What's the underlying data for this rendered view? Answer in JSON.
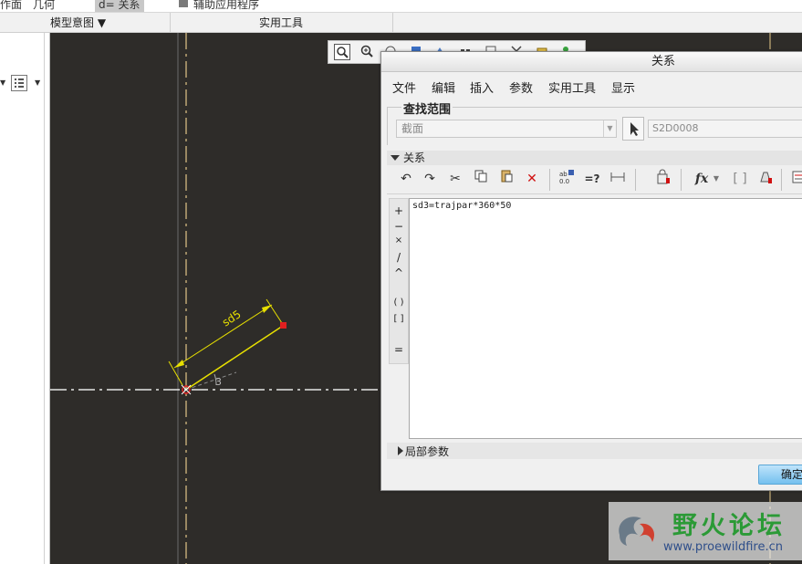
{
  "ribbon": {
    "top_items": [
      "作面",
      "几何",
      "d= 关系",
      "辅助应用程序"
    ],
    "groups": [
      "模型意图 ▼",
      "实用工具"
    ]
  },
  "sketch": {
    "dimension_label": "sd5",
    "angle_label": "3"
  },
  "dialog": {
    "title": "关系",
    "menu": [
      "文件",
      "编辑",
      "插入",
      "参数",
      "实用工具",
      "显示"
    ],
    "lookup_label": "查找范围",
    "scope_value": "截面",
    "selection_value": "S2D0008",
    "relations_label": "关系",
    "ops": [
      "+",
      "−",
      "×",
      "/",
      "^",
      "( )",
      "[ ]",
      "="
    ],
    "relation_text": "sd3=trajpar*360*50",
    "local_params_label": "局部参数",
    "ok_label": "确定"
  },
  "watermark": {
    "title": "野火论坛",
    "url": "www.proewildfire.cn"
  },
  "colors": {
    "canvas": "#2e2c29",
    "dimension": "#e8e000",
    "point": "#e02020",
    "ok_button": "#74c0ee",
    "watermark_green": "#2b9a36"
  }
}
